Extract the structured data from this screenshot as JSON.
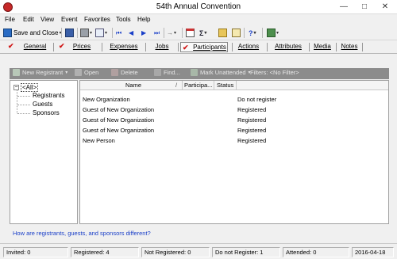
{
  "window": {
    "title": "54th Annual Convention",
    "minimize_glyph": "—",
    "maximize_glyph": "□",
    "close_glyph": "✕"
  },
  "menu": [
    "File",
    "Edit",
    "View",
    "Event",
    "Favorites",
    "Tools",
    "Help"
  ],
  "toolbar": {
    "save_and_close_label": "Save and Close",
    "help_glyph": "?",
    "sum_glyph": "Σ",
    "arrow_glyph": "→",
    "dropdown_glyph": "▾",
    "nav_glyphs": [
      "⏮",
      "◀",
      "▶",
      "⏭"
    ]
  },
  "tabs": [
    {
      "label": "General",
      "checked": true
    },
    {
      "label": "Prices",
      "checked": true
    },
    {
      "label": "Expenses",
      "checked": false
    },
    {
      "label": "Jobs",
      "checked": false
    },
    {
      "label": "Participants",
      "checked": true,
      "active": true
    },
    {
      "label": "Actions",
      "checked": false
    },
    {
      "label": "Attributes",
      "checked": false
    },
    {
      "label": "Media",
      "checked": false
    },
    {
      "label": "Notes",
      "checked": false
    }
  ],
  "check_glyph": "✔",
  "actions": {
    "new_registrant": "New Registrant",
    "open": "Open",
    "delete": "Delete",
    "find": "Find...",
    "mark_unattended": "Mark Unattended",
    "filters": "Filters: <No Filter>",
    "dropdown_glyph": "▾"
  },
  "tree": {
    "collapse_glyph": "−",
    "root": "<All>",
    "children": [
      "Registrants",
      "Guests",
      "Sponsors"
    ]
  },
  "grid": {
    "columns": [
      "Name",
      "Participa...",
      "Status"
    ],
    "sort_glyph": "/",
    "rows": [
      {
        "name": "New Organization",
        "participation": "",
        "status": "Do not register"
      },
      {
        "name": "Guest of New Organization",
        "participation": "",
        "status": "Registered"
      },
      {
        "name": "Guest of New Organization",
        "participation": "",
        "status": "Registered"
      },
      {
        "name": "Guest of New Organization",
        "participation": "",
        "status": "Registered"
      },
      {
        "name": "New Person",
        "participation": "",
        "status": "Registered"
      }
    ]
  },
  "help_link": "How are registrants, guests, and sponsors different?",
  "status_bar": [
    "Invited: 0",
    "Registered: 4",
    "Not Registered: 0",
    "Do not Register: 1",
    "Attended: 0",
    "2016-04-18"
  ],
  "colors": {
    "accent_blue": "#1a3fc8",
    "check_red": "#d01818",
    "actionbar_gray": "#8c8c8c"
  }
}
